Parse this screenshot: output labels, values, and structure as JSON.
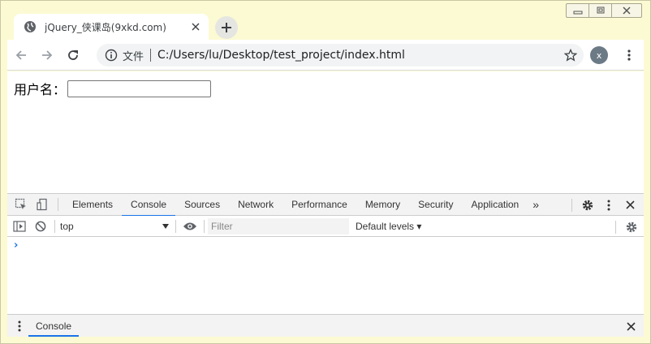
{
  "tab": {
    "title": "jQuery_侠课岛(9xkd.com)"
  },
  "address_bar": {
    "site_label": "文件",
    "url": "C:/Users/lu/Desktop/test_project/index.html"
  },
  "profile": {
    "initial": "x"
  },
  "page": {
    "username_label": "用户名：",
    "username_value": ""
  },
  "devtools": {
    "tabs": [
      "Elements",
      "Console",
      "Sources",
      "Network",
      "Performance",
      "Memory",
      "Security",
      "Application"
    ],
    "more_tabs": "»",
    "active_tab": "Console",
    "console_toolbar": {
      "context": "top",
      "filter_placeholder": "Filter",
      "levels": "Default levels ▾"
    },
    "prompt_symbol": "›",
    "drawer_tab": "Console"
  },
  "colors": {
    "window_frame": "#fbfad3",
    "accent": "#1a73e8",
    "avatar": "#6c7a86"
  }
}
